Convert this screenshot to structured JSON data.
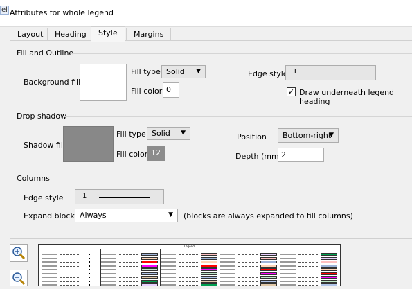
{
  "window": {
    "help_icon_text": "el",
    "title": "Attributes for whole legend"
  },
  "tabs": [
    "Layout",
    "Heading",
    "Style",
    "Margins"
  ],
  "fill_outline": {
    "title": "Fill and Outline",
    "background_fill_label": "Background fill",
    "fill_type_label": "Fill type",
    "fill_type_value": "Solid",
    "fill_color_label": "Fill color",
    "fill_color_value": "0",
    "edge_style_label": "Edge style",
    "edge_style_value": "1",
    "draw_underneath_label": "Draw underneath legend heading",
    "draw_underneath_checked": true
  },
  "drop_shadow": {
    "title": "Drop shadow",
    "shadow_fill_label": "Shadow fill",
    "fill_type_label": "Fill type",
    "fill_type_value": "Solid",
    "fill_color_label": "Fill color",
    "fill_color_value": "12",
    "position_label": "Position",
    "position_value": "Bottom-right",
    "depth_label": "Depth (mm)",
    "depth_value": "2"
  },
  "columns": {
    "title": "Columns",
    "edge_style_label": "Edge style",
    "edge_style_value": "1",
    "expand_blocks_label": "Expand blocks",
    "expand_blocks_value": "Always",
    "expand_note": "(blocks are always expanded to fill columns)"
  },
  "colors": {
    "shadow_swatch": "#888888",
    "fill_color_12": "#8c8c8c",
    "preview_swatches": [
      "#9fb4d8",
      "#ffd5b8",
      "#ff0000",
      "#ff00ff",
      "#bfe8c8",
      "#b0c4e8",
      "#e0c8a8",
      "#00a050",
      "#e8d0ff",
      "#ffc0c0"
    ]
  },
  "preview": {
    "title": "Legend"
  }
}
